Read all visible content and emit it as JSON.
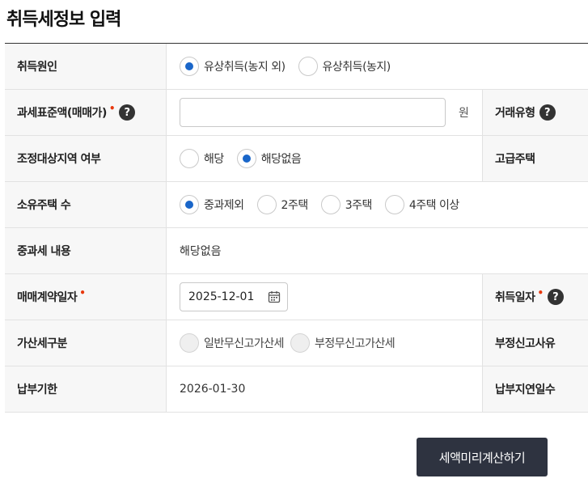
{
  "page": {
    "title": "취득세정보 입력"
  },
  "rows": {
    "reason": {
      "label": "취득원인",
      "options": [
        {
          "label": "유상취득(농지 외)",
          "checked": true
        },
        {
          "label": "유상취득(농지)",
          "checked": false
        }
      ]
    },
    "tax_base": {
      "label": "과세표준액(매매가)",
      "required_mark": "•",
      "help": "?",
      "value": "",
      "unit": "원",
      "side_label": "거래유형",
      "side_help": "?"
    },
    "adjust_area": {
      "label": "조정대상지역 여부",
      "options": [
        {
          "label": "해당",
          "checked": false
        },
        {
          "label": "해당없음",
          "checked": true
        }
      ],
      "side_label": "고급주택"
    },
    "house_count": {
      "label": "소유주택 수",
      "options": [
        {
          "label": "중과제외",
          "checked": true
        },
        {
          "label": "2주택",
          "checked": false
        },
        {
          "label": "3주택",
          "checked": false
        },
        {
          "label": "4주택 이상",
          "checked": false
        }
      ]
    },
    "heavy_tax": {
      "label": "중과세 내용",
      "value": "해당없음"
    },
    "contract_date": {
      "label": "매매계약일자",
      "required_mark": "•",
      "value": "2025-12-01",
      "side_label": "취득일자",
      "side_required_mark": "•",
      "side_help": "?"
    },
    "penalty_type": {
      "label": "가산세구분",
      "options": [
        {
          "label": "일반무신고가산세",
          "checked": false,
          "disabled": true
        },
        {
          "label": "부정무신고가산세",
          "checked": false,
          "disabled": true
        }
      ],
      "side_label": "부정신고사유"
    },
    "due_date": {
      "label": "납부기한",
      "value": "2026-01-30",
      "side_label": "납부지연일수"
    }
  },
  "actions": {
    "calculate_label": "세액미리계산하기"
  },
  "colors": {
    "accent": "#1a66c9",
    "required": "#e8380d",
    "button_bg": "#2e3340",
    "header_bg": "#f7f7f7"
  }
}
